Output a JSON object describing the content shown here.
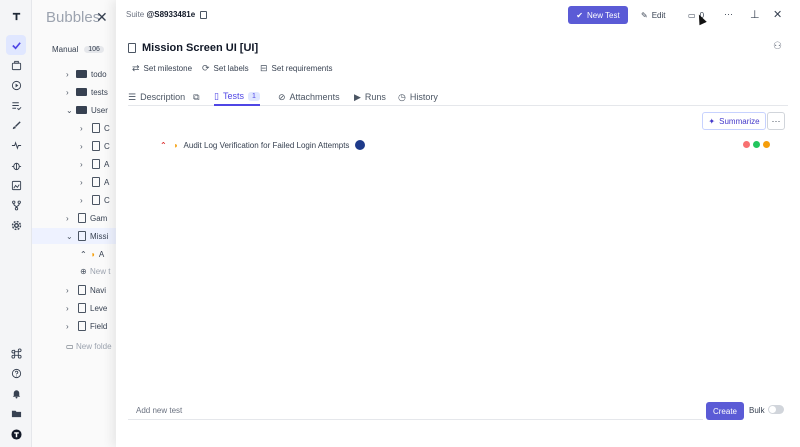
{
  "sidebar": {
    "title": "Bubbles",
    "close": "✕",
    "manual_label": "Manual",
    "manual_count": "106",
    "items": [
      {
        "label": "todo"
      },
      {
        "label": "tests"
      },
      {
        "label": "User"
      },
      {
        "label": "C"
      },
      {
        "label": "C"
      },
      {
        "label": "A"
      },
      {
        "label": "A"
      },
      {
        "label": "C"
      },
      {
        "label": "Gam"
      },
      {
        "label": "Missi"
      },
      {
        "label": "A"
      },
      {
        "label": "New t"
      },
      {
        "label": "Navi"
      },
      {
        "label": "Leve"
      },
      {
        "label": "Field"
      },
      {
        "label": "New folde"
      }
    ]
  },
  "topbar": {
    "suite_prefix": "Suite",
    "suite_id": "@S8933481e",
    "new_test_label": "New Test",
    "edit_label": "Edit",
    "comments_count": "0",
    "more": "···",
    "close": "✕"
  },
  "suite": {
    "title": "Mission Screen UI [UI]"
  },
  "actions": {
    "set_milestone": "Set milestone",
    "set_labels": "Set labels",
    "set_requirements": "Set requirements"
  },
  "tabs": [
    {
      "label": "Description"
    },
    {
      "label": "Tests",
      "badge": "1"
    },
    {
      "label": "Attachments"
    },
    {
      "label": "Runs"
    },
    {
      "label": "History"
    }
  ],
  "summarize_label": "Summarize",
  "tests": [
    {
      "title": "Audit Log Verification for Failed Login Attempts"
    }
  ],
  "bottom": {
    "placeholder": "Add new test",
    "create_label": "Create",
    "bulk_label": "Bulk"
  },
  "colors": {
    "accent": "#5b5bd6",
    "priority": "#dc2626",
    "status_red": "#f87171",
    "status_green": "#22c55e",
    "status_yellow": "#f59e0b"
  }
}
